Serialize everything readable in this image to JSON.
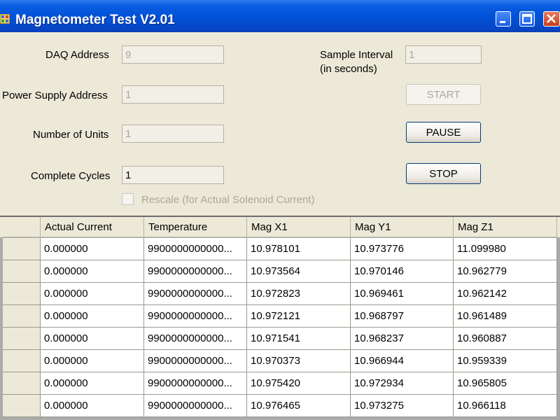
{
  "window": {
    "title": "Magnetometer Test V2.01",
    "icon": "app-window-icon",
    "controls": [
      "minimize-icon",
      "maximize-icon",
      "close-icon"
    ]
  },
  "form": {
    "daq_address": {
      "label": "DAQ Address",
      "value": "9"
    },
    "power_supply_address": {
      "label": "Power Supply Address",
      "value": "1"
    },
    "number_of_units": {
      "label": "Number of Units",
      "value": "1"
    },
    "complete_cycles": {
      "label": "Complete Cycles",
      "value": "1"
    },
    "sample_interval": {
      "label_line1": "Sample Interval",
      "label_line2": "(in seconds)",
      "value": "1"
    },
    "start_label": "START",
    "pause_label": "PAUSE",
    "stop_label": "STOP",
    "rescale_label": "Rescale (for Actual Solenoid Current)"
  },
  "grid": {
    "columns": [
      "Actual Current",
      "Temperature",
      "Mag X1",
      "Mag Y1",
      "Mag Z1"
    ],
    "rows": [
      [
        "0.000000",
        "9900000000000...",
        "10.978101",
        "10.973776",
        "11.099980"
      ],
      [
        "0.000000",
        "9900000000000...",
        "10.973564",
        "10.970146",
        "10.962779"
      ],
      [
        "0.000000",
        "9900000000000...",
        "10.972823",
        "10.969461",
        "10.962142"
      ],
      [
        "0.000000",
        "9900000000000...",
        "10.972121",
        "10.968797",
        "10.961489"
      ],
      [
        "0.000000",
        "9900000000000...",
        "10.971541",
        "10.968237",
        "10.960887"
      ],
      [
        "0.000000",
        "9900000000000...",
        "10.970373",
        "10.966944",
        "10.959339"
      ],
      [
        "0.000000",
        "9900000000000...",
        "10.975420",
        "10.972934",
        "10.965805"
      ],
      [
        "0.000000",
        "9900000000000...",
        "10.976465",
        "10.973275",
        "10.966118"
      ]
    ]
  },
  "colors": {
    "titlebar": "#0052d8",
    "dialog_bg": "#ece9d8",
    "grid_bg": "#ababab",
    "button_border": "#003c74"
  }
}
